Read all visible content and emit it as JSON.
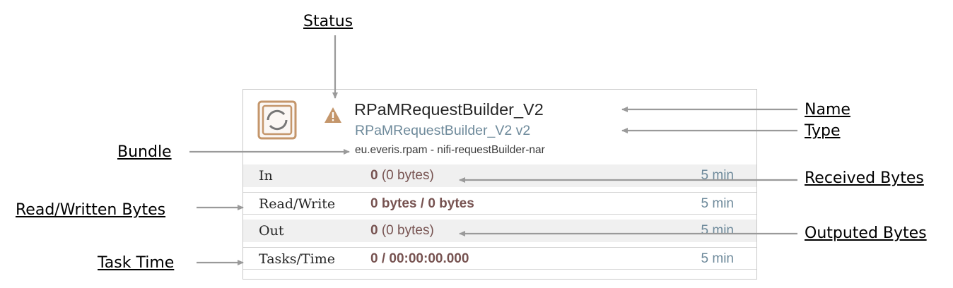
{
  "annotations": {
    "status": "Status",
    "name": "Name",
    "type": "Type",
    "bundle": "Bundle",
    "received_bytes": "Received Bytes",
    "read_written_bytes": "Read/Written Bytes",
    "outputed_bytes": "Outputed Bytes",
    "task_time": "Task Time"
  },
  "processor": {
    "icon": "processor-icon",
    "status_icon": "warning-icon",
    "status_color": "#c4966b",
    "name": "RPaMRequestBuilder_V2",
    "type": "RPaMRequestBuilder_V2 v2",
    "bundle": "eu.everis.rpam - nifi-requestBuilder-nar",
    "stats": [
      {
        "label": "In",
        "value_bold": "0",
        "value_rest": " (0 bytes)",
        "time": "5 min"
      },
      {
        "label": "Read/Write",
        "value_bold": "0 bytes / 0 bytes",
        "value_rest": "",
        "time": "5 min"
      },
      {
        "label": "Out",
        "value_bold": "0",
        "value_rest": " (0 bytes)",
        "time": "5 min"
      },
      {
        "label": "Tasks/Time",
        "value_bold": "0 / 00:00:00.000",
        "value_rest": "",
        "time": "5 min"
      }
    ]
  }
}
